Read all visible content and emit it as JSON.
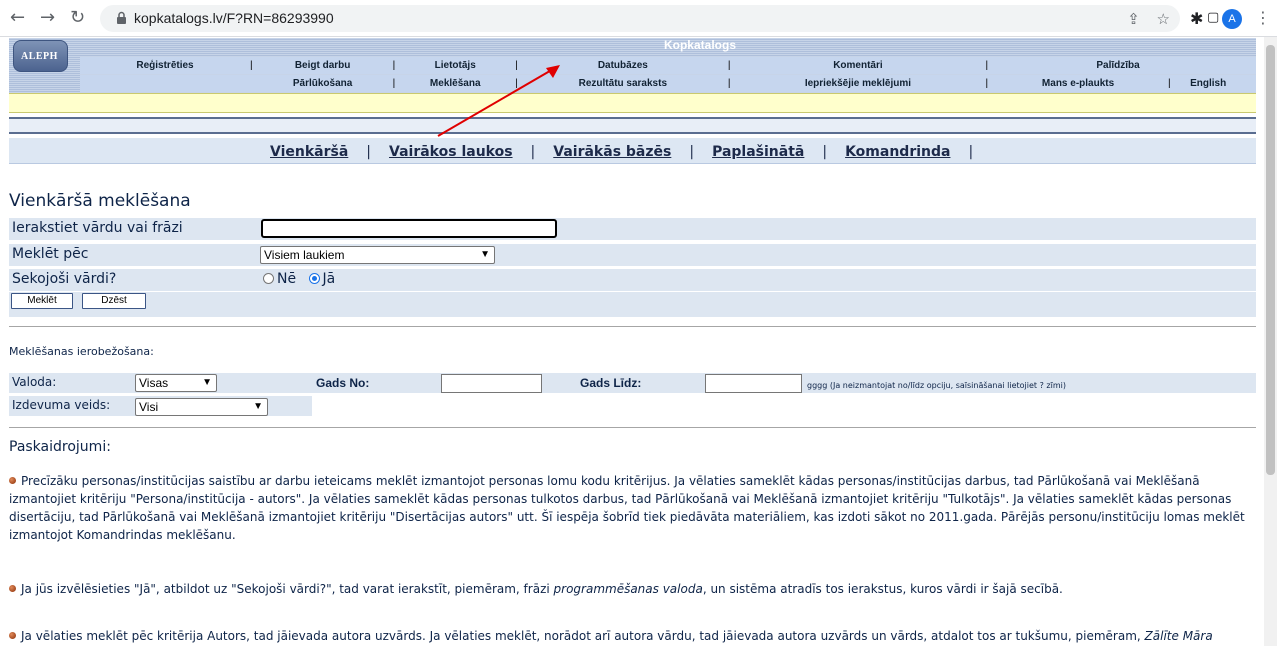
{
  "browser": {
    "url": "kopkatalogs.lv/F?RN=86293990",
    "avatar_letter": "A",
    "icons": [
      "back-arrow-icon",
      "forward-arrow-icon",
      "reload-icon",
      "lock-icon",
      "share-icon",
      "star-icon",
      "extensions-icon",
      "side-panel-icon",
      "more-menu-icon"
    ]
  },
  "header": {
    "logo_text": "ALEPH",
    "title": "Kopkatalogs",
    "top_menu": [
      "Reģistrēties",
      "Beigt darbu",
      "Lietotājs",
      "Datubāzes",
      "Komentāri",
      "Palīdzība"
    ],
    "sub_menu": [
      "Pārlūkošana",
      "Meklēšana",
      "Rezultātu saraksts",
      "Iepriekšējie meklējumi",
      "Mans e-plaukts",
      "English"
    ]
  },
  "search_tabs": [
    "Vienkāršā",
    "Vairākos laukos",
    "Vairākās bāzēs",
    "Paplašinātā",
    "Komandrinda"
  ],
  "form": {
    "title": "Vienkāršā meklēšana",
    "query_label": "Ierakstiet vārdu vai frāzi",
    "query_value": "",
    "search_by_label": "Meklēt pēc",
    "search_by_value": "Visiem laukiem",
    "adjacent_label": "Sekojoši vārdi?",
    "adjacent_options": [
      "Nē",
      "Jā"
    ],
    "adjacent_selected": "Jā",
    "search_button": "Meklēt",
    "clear_button": "Dzēst"
  },
  "limits": {
    "title": "Meklēšanas ierobežošana:",
    "language_label": "Valoda:",
    "language_value": "Visas",
    "year_from_label": "Gads No:",
    "year_from_value": "",
    "year_to_label": "Gads Līdz:",
    "year_to_value": "",
    "year_hint": "gggg (Ja neizmantojat no/līdz opciju, saīsināšanai lietojiet ? zīmi)",
    "format_label": "Izdevuma veids:",
    "format_value": "Visi"
  },
  "explanations": {
    "title": "Paskaidrojumi:",
    "p1": "Precīzāku personas/institūcijas saistību ar darbu ieteicams meklēt izmantojot personas lomu kodu kritērijus. Ja vēlaties sameklēt kādas personas/institūcijas darbus, tad Pārlūkošanā vai Meklēšanā izmantojiet kritēriju \"Persona/institūcija - autors\". Ja vēlaties sameklēt kādas personas tulkotos darbus, tad Pārlūkošanā vai Meklēšanā izmantojiet kritēriju \"Tulkotājs\". Ja vēlaties sameklēt kādas personas disertāciju, tad Pārlūkošanā vai Meklēšanā izmantojiet kritēriju \"Disertācijas autors\" utt. Šī iespēja šobrīd tiek piedāvāta materiāliem, kas izdoti sākot no 2011.gada. Pārējās personu/institūciju lomas meklēt izmantojot Komandrindas meklēšanu.",
    "p2_before": "Ja jūs izvēlēsieties \"Jā\", atbildot uz \"Sekojoši vārdi?\", tad varat ierakstīt, piemēram, frāzi ",
    "p2_italic": "programmēšanas valoda",
    "p2_after": ", un sistēma atradīs tos ierakstus, kuros vārdi ir šajā secībā.",
    "p3_before": "Ja vēlaties meklēt pēc kritērija Autors, tad jāievada autora uzvārds. Ja vēlaties meklēt, norādot arī autora vārdu, tad jāievada autora uzvārds un vārds, atdalot tos ar tukšumu, piemēram, ",
    "p3_italic": "Zālīte Māra"
  },
  "colors": {
    "header_blue": "#b8c8e0",
    "text_navy": "#0e2448",
    "form_row_bg": "#dde6f1",
    "yellow_band": "#ffffcc",
    "annotation_arrow": "#e00000"
  }
}
